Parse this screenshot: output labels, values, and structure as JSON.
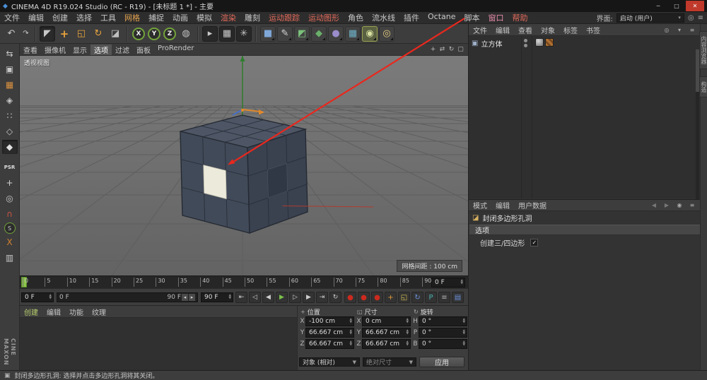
{
  "window": {
    "title": "CINEMA 4D R19.024 Studio (RC - R19) - [未标题 1 *] - 主要",
    "app_icon": "◆",
    "minimize": "─",
    "maximize": "□",
    "close": "✕"
  },
  "menu_bar": {
    "items": [
      {
        "t": "文件"
      },
      {
        "t": "编辑"
      },
      {
        "t": "创建"
      },
      {
        "t": "选择"
      },
      {
        "t": "工具"
      },
      {
        "t": "网格",
        "c": "#e2a14e"
      },
      {
        "t": "捕捉"
      },
      {
        "t": "动画"
      },
      {
        "t": "模拟"
      },
      {
        "t": "渲染",
        "c": "#e26a5a"
      },
      {
        "t": "雕刻"
      },
      {
        "t": "运动跟踪",
        "c": "#e26a5a"
      },
      {
        "t": "运动图形",
        "c": "#e26a5a"
      },
      {
        "t": "角色"
      },
      {
        "t": "流水线"
      },
      {
        "t": "插件"
      },
      {
        "t": "Octane"
      },
      {
        "t": "脚本"
      },
      {
        "t": "窗口",
        "c": "#e288a8"
      },
      {
        "t": "帮助",
        "c": "#e26a5a"
      }
    ],
    "interface_label": "界面:",
    "interface_value": "启动 (用户)"
  },
  "toolbar": {
    "items": [
      {
        "n": "undo-button",
        "g": "↶"
      },
      {
        "n": "redo-button",
        "g": "↷",
        "cls": "small"
      },
      {
        "sep": true
      },
      {
        "n": "live-selection-tool",
        "g": "◤",
        "cls": "pressed"
      },
      {
        "n": "move-tool",
        "g": "+",
        "c": "#e8a33d",
        "cls": "bold"
      },
      {
        "n": "scale-tool",
        "g": "◱",
        "c": "#e8a33d"
      },
      {
        "n": "rotate-tool",
        "g": "↻",
        "c": "#e8a33d"
      },
      {
        "n": "last-used-tool",
        "g": "◪",
        "c": "#c0c0c0"
      },
      {
        "sep": true
      },
      {
        "n": "lock-x-button",
        "g": "X",
        "cls": "axis"
      },
      {
        "n": "lock-y-button",
        "g": "Y",
        "cls": "axis"
      },
      {
        "n": "lock-z-button",
        "g": "Z",
        "cls": "axis"
      },
      {
        "n": "coord-system-button",
        "g": "◍",
        "c": "#c0c0c0"
      },
      {
        "sep": true
      },
      {
        "n": "render-view-button",
        "g": "▸",
        "cls": "render"
      },
      {
        "n": "render-picture-viewer-button",
        "g": "▦",
        "cls": "render"
      },
      {
        "n": "render-settings-button",
        "g": "✳",
        "cls": "render"
      },
      {
        "sep": true
      },
      {
        "n": "cube-primitive-button",
        "g": "■",
        "c": "#7fa8d9",
        "cls": "flyout"
      },
      {
        "n": "spline-pen-button",
        "g": "✎",
        "c": "#d8d8d8",
        "cls": "flyout"
      },
      {
        "n": "subdivision-surface-button",
        "g": "◩",
        "c": "#7ac07a",
        "cls": "flyout"
      },
      {
        "n": "deformer-button",
        "g": "◆",
        "c": "#6ab06a",
        "cls": "flyout"
      },
      {
        "n": "environment-object-button",
        "g": "●",
        "c": "#9b8ccc",
        "cls": "flyout"
      },
      {
        "n": "instance-array-button",
        "g": "▦",
        "c": "#6fb3c9",
        "cls": "flyout"
      },
      {
        "n": "camera-button",
        "g": "◉",
        "c": "#d8e0a0",
        "cls": "flyout active"
      },
      {
        "n": "light-button",
        "g": "◎",
        "c": "#e8d080",
        "cls": "flyout"
      }
    ]
  },
  "left_toolbar": {
    "items": [
      {
        "n": "make-editable-button",
        "g": "⇆",
        "c": "#c8c8c8"
      },
      {
        "n": "model-mode-button",
        "g": "▣",
        "c": "#c8c8c8"
      },
      {
        "n": "texture-mode-button",
        "g": "▦",
        "c": "#d89040"
      },
      {
        "n": "workplane-mode-button",
        "g": "◈",
        "c": "#c8c8c8"
      },
      {
        "n": "points-mode-button",
        "g": "∷",
        "c": "#c8c8c8"
      },
      {
        "n": "edges-mode-button",
        "g": "◇",
        "c": "#c8c8c8"
      },
      {
        "n": "polygons-mode-button",
        "g": "◆",
        "c": "#e0e0e0",
        "cls": "pressed"
      },
      {
        "sep": true
      },
      {
        "n": "psr-label",
        "g": "PSR",
        "cls": "txt"
      },
      {
        "n": "enable-axis-button",
        "g": "+",
        "c": "#d0d0d0"
      },
      {
        "n": "viewport-solo-button",
        "g": "◎",
        "c": "#c8c8c8"
      },
      {
        "n": "snap-button",
        "g": "∩",
        "c": "#cc5544"
      },
      {
        "n": "snap-settings-button",
        "g": "S",
        "cls": "axis"
      },
      {
        "n": "workplane-snap-button",
        "g": "X",
        "c": "#d08030"
      },
      {
        "n": "quantize-button",
        "g": "▥",
        "c": "#c8c8c8"
      }
    ],
    "logo_primary": "MAXON",
    "logo_secondary": "CINE"
  },
  "viewport": {
    "menu": [
      {
        "t": "查看"
      },
      {
        "t": "摄像机"
      },
      {
        "t": "显示"
      },
      {
        "t": "选项",
        "hl": true
      },
      {
        "t": "过滤"
      },
      {
        "t": "面板"
      },
      {
        "t": "ProRender"
      }
    ],
    "nav_icons": [
      {
        "n": "pan-view-icon",
        "g": "+"
      },
      {
        "n": "zoom-view-icon",
        "g": "⇄"
      },
      {
        "n": "rotate-view-icon",
        "g": "↻"
      },
      {
        "n": "toggle-views-icon",
        "g": "▢"
      }
    ],
    "view_label": "透视视图",
    "grid_label": "网格间距 : 100 cm",
    "colors": {
      "axis_x": "#b23a2e",
      "axis_y": "#2f7d2f",
      "axis_z": "#3f6fd0",
      "highlight_polygon": "#eceadb",
      "annotation_arrow": "#e8281e"
    }
  },
  "timeline": {
    "ticks": [
      "0",
      "5",
      "10",
      "15",
      "20",
      "25",
      "30",
      "35",
      "40",
      "45",
      "50",
      "55",
      "60",
      "65",
      "70",
      "75",
      "80",
      "85",
      "90"
    ],
    "ruler_field": "0 F",
    "start_field": "0 F",
    "range_start": "0 F",
    "range_end": "90 F",
    "end_field": "90 F",
    "transport": [
      {
        "n": "goto-start-button",
        "g": "⇤"
      },
      {
        "n": "previous-key-button",
        "g": "◁"
      },
      {
        "n": "previous-frame-button",
        "g": "◀"
      },
      {
        "n": "play-button",
        "g": "▶",
        "c": "#7ac04a"
      },
      {
        "n": "next-frame-button",
        "g": "▷"
      },
      {
        "n": "next-key-button",
        "g": "▶"
      },
      {
        "n": "goto-end-button",
        "g": "⇥"
      },
      {
        "n": "loop-button",
        "g": "↻"
      }
    ],
    "record_buttons": [
      {
        "n": "record-keyframe-button",
        "g": "●",
        "c": "#cc2a1e"
      },
      {
        "n": "autokeying-button",
        "g": "●",
        "c": "#cc2a1e"
      },
      {
        "n": "record-selected-button",
        "g": "●",
        "c": "#cc2a1e"
      },
      {
        "n": "keyframe-position-toggle",
        "g": "+",
        "c": "#e09a3c"
      },
      {
        "n": "keyframe-scale-toggle",
        "g": "◱",
        "c": "#d8c050"
      },
      {
        "n": "keyframe-rotation-toggle",
        "g": "↻",
        "c": "#6a8fd8"
      },
      {
        "n": "keyframe-parameter-toggle",
        "g": "P",
        "c": "#4ab0b0"
      },
      {
        "n": "keyframe-pla-toggle",
        "g": "≡",
        "c": "#b0b0b0"
      },
      {
        "n": "keyframe-selection-button",
        "g": "▤",
        "c": "#6a8fd8"
      }
    ]
  },
  "materials_panel": {
    "menu": [
      {
        "t": "创建",
        "c": "#b9cf6e"
      },
      {
        "t": "编辑"
      },
      {
        "t": "功能"
      },
      {
        "t": "纹理"
      }
    ]
  },
  "coordinates": {
    "panel_menu_icon": "≡",
    "columns": [
      {
        "key": "position",
        "header": "位置",
        "icon": "+",
        "fields": [
          {
            "label": "X",
            "value": "-100 cm"
          },
          {
            "label": "Y",
            "value": "66.667 cm"
          },
          {
            "label": "Z",
            "value": "66.667 cm"
          }
        ]
      },
      {
        "key": "size",
        "header": "尺寸",
        "icon": "◱",
        "fields": [
          {
            "label": "X",
            "value": "0 cm"
          },
          {
            "label": "Y",
            "value": "66.667 cm"
          },
          {
            "label": "Z",
            "value": "66.667 cm"
          }
        ]
      },
      {
        "key": "rotation",
        "header": "旋转",
        "icon": "↻",
        "fields": [
          {
            "label": "H",
            "value": "0 °"
          },
          {
            "label": "P",
            "value": "0 °"
          },
          {
            "label": "B",
            "value": "0 °"
          }
        ]
      }
    ],
    "mode_dropdown": "对象 (相对)",
    "size_dropdown": "绝对尺寸",
    "apply_button": "应用"
  },
  "object_manager": {
    "menu": [
      {
        "t": "文件"
      },
      {
        "t": "编辑"
      },
      {
        "t": "查看"
      },
      {
        "t": "对象"
      },
      {
        "t": "标签"
      },
      {
        "t": "书签"
      }
    ],
    "nav_icons": [
      {
        "n": "om-search-icon",
        "g": "◎"
      },
      {
        "n": "om-filter-icon",
        "g": "▾"
      },
      {
        "n": "om-settings-icon",
        "g": "≡"
      }
    ],
    "objects": [
      {
        "name": "立方体",
        "icon": "▣"
      }
    ]
  },
  "attribute_manager": {
    "menu": [
      {
        "t": "模式"
      },
      {
        "t": "编辑"
      },
      {
        "t": "用户数据"
      }
    ],
    "nav_icons": [
      {
        "n": "history-back-icon",
        "g": "◀",
        "c": "#777777"
      },
      {
        "n": "history-forward-icon",
        "g": "▶",
        "c": "#777777"
      },
      {
        "n": "am-pin-icon",
        "g": "◉",
        "c": "#aaaaaa"
      },
      {
        "n": "am-menu-icon",
        "g": "≡",
        "c": "#aaaaaa"
      }
    ],
    "tool_icon": "◪",
    "tool_name": "封闭多边形孔洞",
    "section_label": "选项",
    "options": [
      {
        "label": "创建三/四边形",
        "checked": true
      }
    ]
  },
  "right_edge_tabs": [
    {
      "t": "内容浏览器",
      "n": "tab-content-browser"
    },
    {
      "t": "构造",
      "n": "tab-structure"
    }
  ],
  "status_bar": {
    "text": "封闭多边形孔洞: 选择并点击多边形孔洞将其关闭。"
  },
  "icons": {
    "spin_up": "▲",
    "spin_down": "▼",
    "dropdown": "▼",
    "check": "✓",
    "slider_left": "◂",
    "slider_right": "▸",
    "status": "▣"
  }
}
